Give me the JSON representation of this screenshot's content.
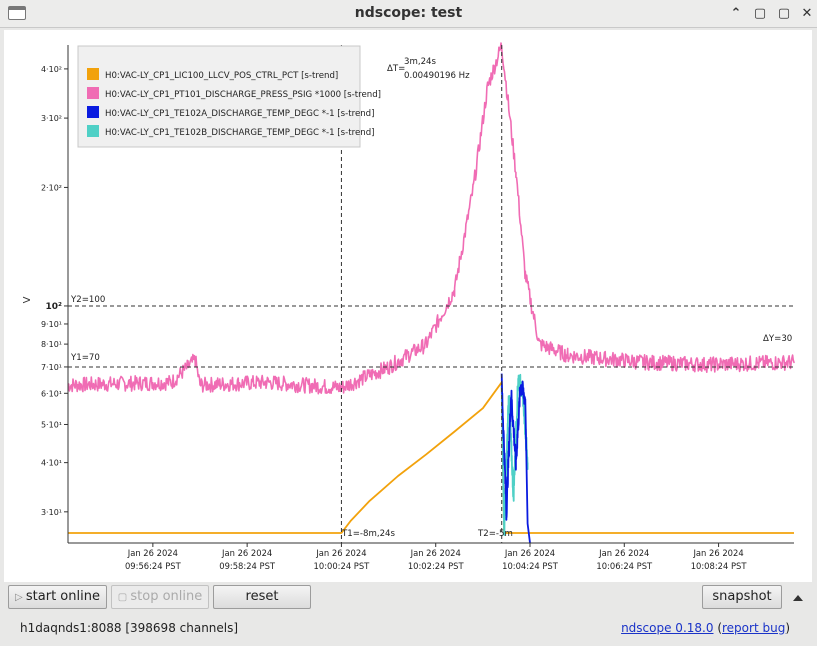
{
  "window": {
    "title": "ndscope: test",
    "controls": [
      "⌃",
      "▢",
      "✕"
    ]
  },
  "legend": [
    {
      "label": "H0:VAC-LY_CP1_LIC100_LLCV_POS_CTRL_PCT [s-trend]",
      "color": "#f2a20c"
    },
    {
      "label": "H0:VAC-LY_CP1_PT101_DISCHARGE_PRESS_PSIG *1000 [s-trend]",
      "color": "#f06cb4"
    },
    {
      "label": "H0:VAC-LY_CP1_TE102A_DISCHARGE_TEMP_DEGC *-1 [s-trend]",
      "color": "#0a1be0"
    },
    {
      "label": "H0:VAC-LY_CP1_TE102B_DISCHARGE_TEMP_DEGC *-1 [s-trend]",
      "color": "#4fd0c6"
    }
  ],
  "cursors": {
    "delta_t_label": "ΔT=",
    "delta_t_value": "3m,24s",
    "delta_t_freq": "0.00490196 Hz",
    "t1_label": "T1=-8m,24s",
    "t2_label": "T2=-5m",
    "y1_label": "Y1=70",
    "y2_label": "Y2=100",
    "delta_y_label": "ΔY=30"
  },
  "chart_data": {
    "type": "line",
    "ylabel": "V",
    "yscale": "log",
    "ylim": [
      25,
      460
    ],
    "y_ticks": [
      {
        "value": 30,
        "label": "3·10¹"
      },
      {
        "value": 40,
        "label": "4·10¹"
      },
      {
        "value": 50,
        "label": "5·10¹"
      },
      {
        "value": 60,
        "label": "6·10¹"
      },
      {
        "value": 70,
        "label": "7·10¹"
      },
      {
        "value": 80,
        "label": "8·10¹"
      },
      {
        "value": 90,
        "label": "9·10¹"
      },
      {
        "value": 100,
        "label": "10²"
      },
      {
        "value": 200,
        "label": "2·10²"
      },
      {
        "value": 300,
        "label": "3·10²"
      },
      {
        "value": 400,
        "label": "4·10²"
      }
    ],
    "x_unit": "minutes relative to the time cursors",
    "xlim": [
      -14.2,
      1.2
    ],
    "x_ticks": [
      {
        "value": -12.4,
        "date": "Jan 26 2024",
        "time": "09:56:24 PST"
      },
      {
        "value": -10.4,
        "date": "Jan 26 2024",
        "time": "09:58:24 PST"
      },
      {
        "value": -8.4,
        "date": "Jan 26 2024",
        "time": "10:00:24 PST"
      },
      {
        "value": -6.4,
        "date": "Jan 26 2024",
        "time": "10:02:24 PST"
      },
      {
        "value": -4.4,
        "date": "Jan 26 2024",
        "time": "10:04:24 PST"
      },
      {
        "value": -2.4,
        "date": "Jan 26 2024",
        "time": "10:06:24 PST"
      },
      {
        "value": -0.4,
        "date": "Jan 26 2024",
        "time": "10:08:24 PST"
      }
    ],
    "cursor_t1": -8.4,
    "cursor_t2": -5.0,
    "cursor_y1": 70,
    "cursor_y2": 100,
    "series": [
      {
        "name": "H0:VAC-LY_CP1_LIC100_LLCV_POS_CTRL_PCT [s-trend]",
        "points": [
          [
            -14.2,
            26.5
          ],
          [
            -8.4,
            26.5
          ],
          [
            -8.2,
            28.5
          ],
          [
            -7.8,
            32
          ],
          [
            -7.2,
            37
          ],
          [
            -6.6,
            42
          ],
          [
            -6.0,
            48
          ],
          [
            -5.4,
            55
          ],
          [
            -5.0,
            64
          ],
          [
            -4.95,
            26.5
          ],
          [
            1.2,
            26.5
          ]
        ]
      },
      {
        "name": "H0:VAC-LY_CP1_PT101_DISCHARGE_PRESS_PSIG *1000 [s-trend]",
        "points": [
          [
            -14.2,
            63
          ],
          [
            -12.0,
            64
          ],
          [
            -11.5,
            73
          ],
          [
            -11.4,
            63
          ],
          [
            -10.0,
            64
          ],
          [
            -8.4,
            62
          ],
          [
            -7.4,
            70
          ],
          [
            -6.6,
            80
          ],
          [
            -6.0,
            110
          ],
          [
            -5.6,
            200
          ],
          [
            -5.3,
            360
          ],
          [
            -5.0,
            460
          ],
          [
            -4.7,
            220
          ],
          [
            -4.5,
            120
          ],
          [
            -4.2,
            80
          ],
          [
            -3.6,
            75
          ],
          [
            -2.0,
            72
          ],
          [
            -0.6,
            71
          ],
          [
            1.2,
            72
          ]
        ]
      },
      {
        "name": "H0:VAC-LY_CP1_TE102A_DISCHARGE_TEMP_DEGC *-1 [s-trend]",
        "points": [
          [
            -5.0,
            64
          ],
          [
            -4.9,
            30
          ],
          [
            -4.8,
            60
          ],
          [
            -4.7,
            40
          ],
          [
            -4.6,
            63
          ],
          [
            -4.5,
            58
          ],
          [
            -4.45,
            28
          ],
          [
            -4.4,
            25
          ]
        ]
      },
      {
        "name": "H0:VAC-LY_CP1_TE102B_DISCHARGE_TEMP_DEGC *-1 [s-trend]",
        "points": [
          [
            -5.0,
            63
          ],
          [
            -4.95,
            26
          ],
          [
            -4.85,
            60
          ],
          [
            -4.75,
            33
          ],
          [
            -4.65,
            66
          ],
          [
            -4.55,
            60
          ],
          [
            -4.45,
            40
          ]
        ]
      }
    ]
  },
  "buttons": {
    "start_online": "start online",
    "stop_online": "stop online",
    "reset": "reset",
    "snapshot": "snapshot"
  },
  "status": {
    "server": "h1daqnds1:8088  [398698 channels]",
    "version_link": "ndscope 0.18.0",
    "report_open": "(",
    "report_link": "report bug",
    "report_close": ")"
  }
}
